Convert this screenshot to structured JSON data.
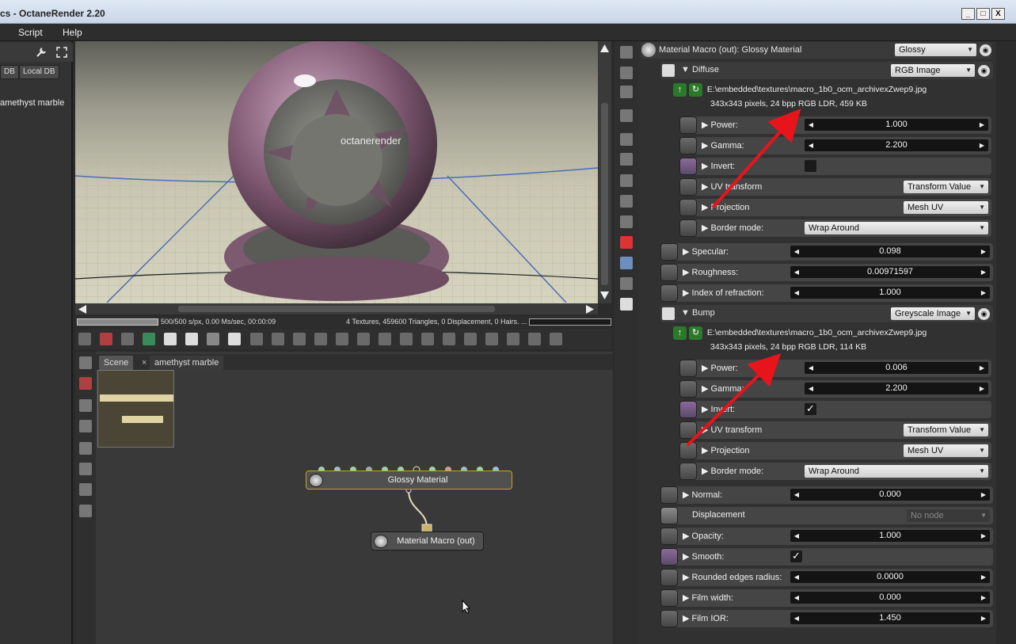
{
  "window": {
    "title": "cs - OctaneRender 2.20",
    "buttons": [
      "_",
      "□",
      "X"
    ]
  },
  "menu": [
    "Script",
    "Help"
  ],
  "left_panel": {
    "tabs": [
      "DB",
      "Local DB"
    ],
    "items": [
      "amethyst marble"
    ]
  },
  "viewport": {
    "logo_text": "octanerender",
    "status_left": "500/500 s/px, 0.00 Ms/sec, 00:00:09",
    "status_right": "4 Textures, 459600 Triangles, 0 Displacement, 0 Hairs. ..."
  },
  "node_editor": {
    "tabs": [
      "Scene",
      "amethyst marble"
    ],
    "nodes": {
      "glossy": "Glossy Material",
      "out": "Material Macro (out)"
    }
  },
  "props": {
    "header": {
      "title": "Material Macro (out): Glossy Material",
      "type": "Glossy"
    },
    "diffuse": {
      "label": "Diffuse",
      "type": "RGB Image",
      "path": "E:\\embedded\\textures\\macro_1b0_ocm_archivexZwep9.jpg",
      "info": "343x343 pixels, 24 bpp RGB LDR, 459 KB",
      "power_label": "Power:",
      "power": "1.000",
      "gamma_label": "Gamma:",
      "gamma": "2.200",
      "invert_label": "Invert:",
      "uv_label": "UV transform",
      "uv_value": "Transform Value",
      "proj_label": "Projection",
      "proj_value": "Mesh UV",
      "border_label": "Border mode:",
      "border_value": "Wrap Around"
    },
    "specular_label": "Specular:",
    "specular": "0.098",
    "roughness_label": "Roughness:",
    "roughness": "0.00971597",
    "ior_label": "Index of refraction:",
    "ior": "1.000",
    "bump": {
      "label": "Bump",
      "type": "Greyscale Image",
      "path": "E:\\embedded\\textures\\macro_1b0_ocm_archivexZwep9.jpg",
      "info": "343x343 pixels, 24 bpp RGB LDR, 114 KB",
      "power_label": "Power:",
      "power": "0.006",
      "gamma_label": "Gamma:",
      "gamma": "2.200",
      "invert_label": "Invert:",
      "invert_mark": "✓",
      "uv_label": "UV transform",
      "uv_value": "Transform Value",
      "proj_label": "Projection",
      "proj_value": "Mesh UV",
      "border_label": "Border mode:",
      "border_value": "Wrap Around"
    },
    "normal_label": "Normal:",
    "normal": "0.000",
    "displacement_label": "Displacement",
    "displacement": "No node",
    "opacity_label": "Opacity:",
    "opacity": "1.000",
    "smooth_label": "Smooth:",
    "smooth_mark": "✓",
    "rounded_label": "Rounded edges radius:",
    "rounded": "0.0000",
    "film_width_label": "Film width:",
    "film_width": "0.000",
    "film_ior_label": "Film IOR:",
    "film_ior": "1.450"
  },
  "colors": {
    "arrow": "#e8141b",
    "node_border": "#c9a227"
  }
}
